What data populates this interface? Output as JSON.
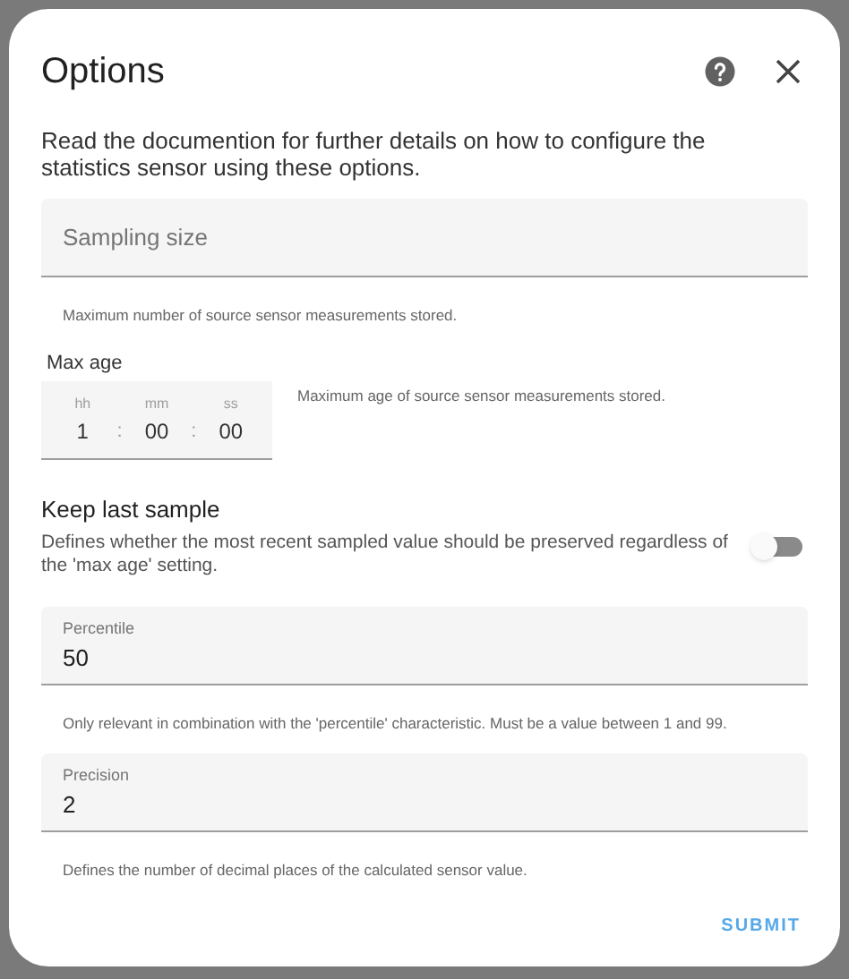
{
  "dialog": {
    "title": "Options",
    "description": "Read the documention for further details on how to configure the statistics sensor using these options."
  },
  "fields": [
    {
      "kind": "text",
      "placeholder": "Sampling size",
      "helper": "Maximum number of source sensor measurements stored."
    },
    {
      "kind": "duration",
      "label": "Max age",
      "parts": [
        {
          "label": "hh",
          "value": "1"
        },
        {
          "label": "mm",
          "value": "00"
        },
        {
          "label": "ss",
          "value": "00"
        }
      ],
      "separator": ":",
      "helper": "Maximum age of source sensor measurements stored."
    },
    {
      "kind": "toggle",
      "label": "Keep last sample",
      "description": "Defines whether the most recent sampled value should be preserved regardless of the 'max age' setting.",
      "on": false
    },
    {
      "kind": "text",
      "label": "Percentile",
      "value": "50",
      "helper": "Only relevant in combination with the 'percentile' characteristic. Must be a value between 1 and 99."
    },
    {
      "kind": "text",
      "label": "Precision",
      "value": "2",
      "helper": "Defines the number of decimal places of the calculated sensor value."
    }
  ],
  "buttons": [
    {
      "label": "SUBMIT"
    }
  ]
}
